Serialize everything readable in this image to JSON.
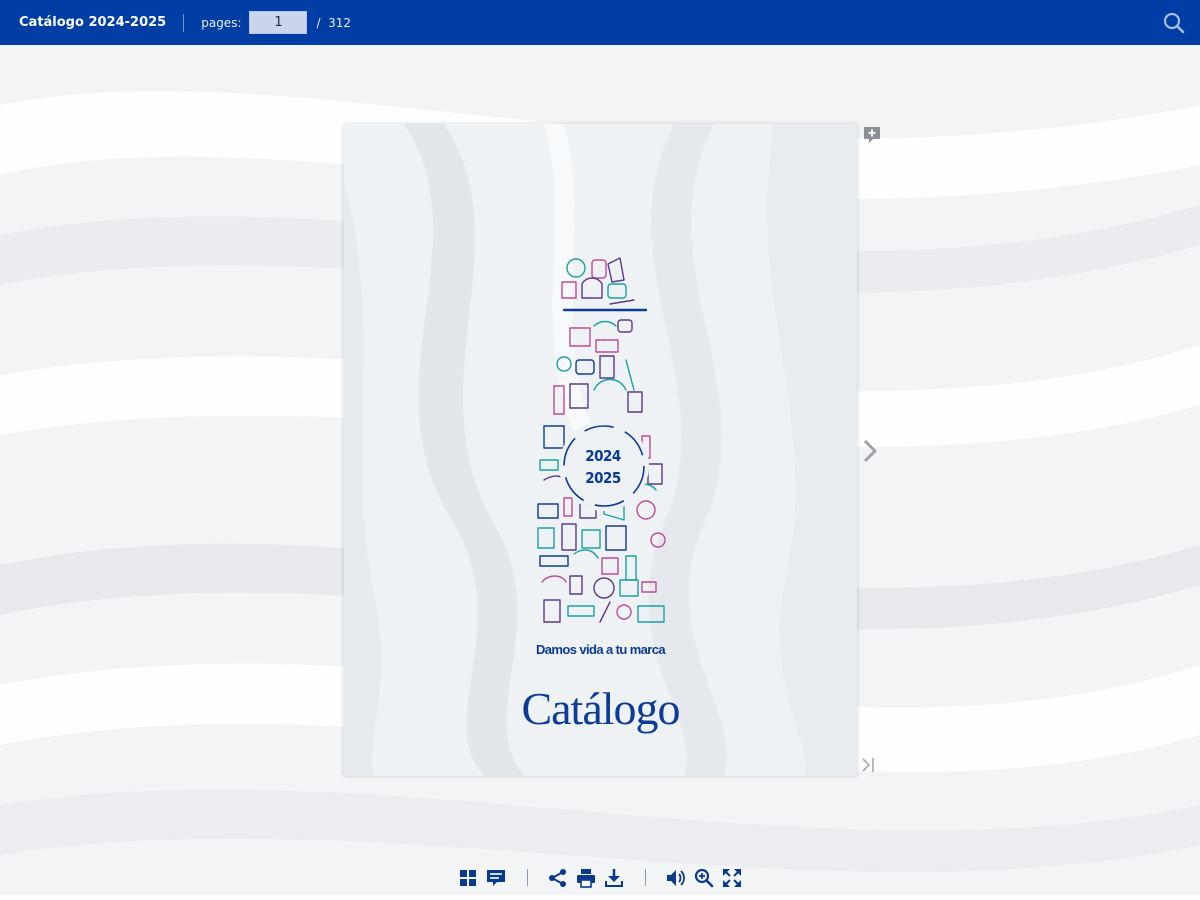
{
  "header": {
    "title": "Catálogo 2024-2025",
    "pages_label": "pages:",
    "current_page": "1",
    "total_pages": "/  312",
    "search_icon": "search-icon"
  },
  "cover": {
    "year_top": "2024",
    "year_bottom": "2025",
    "slogan": "Damos vida a tu marca",
    "logo": "Catálogo"
  },
  "side_controls": {
    "add_note_icon": "add-comment-icon",
    "next_icon": "chevron-right-icon",
    "last_icon": "last-page-icon"
  },
  "toolbar": {
    "groups": [
      [
        "thumbnails-icon",
        "comments-icon"
      ],
      [
        "share-icon",
        "print-icon",
        "download-icon"
      ],
      [
        "volume-icon",
        "zoom-in-icon",
        "fullscreen-icon"
      ]
    ]
  },
  "colors": {
    "topbar": "#003da5",
    "icon": "#0a3a8f",
    "brand_blue": "#0d3c98",
    "teal": "#19a3a0",
    "magenta": "#c24a94",
    "purple": "#5b3b8c"
  }
}
